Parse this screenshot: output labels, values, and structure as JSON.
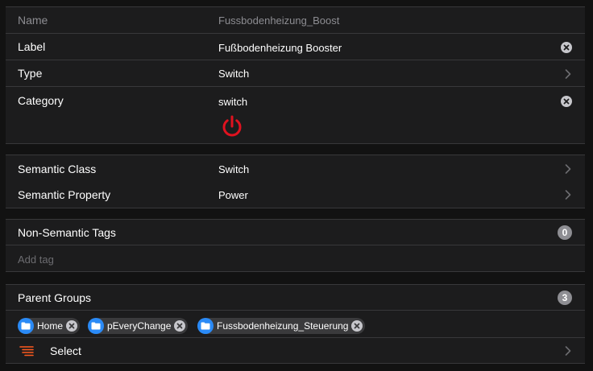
{
  "item": {
    "name_label": "Name",
    "name_value": "Fussbodenheizung_Boost",
    "label_label": "Label",
    "label_value": "Fußbodenheizung Booster",
    "type_label": "Type",
    "type_value": "Switch",
    "category_label": "Category",
    "category_value": "switch",
    "category_icon": "power-icon"
  },
  "semantics": {
    "class_label": "Semantic Class",
    "class_value": "Switch",
    "property_label": "Semantic Property",
    "property_value": "Power"
  },
  "tags": {
    "title": "Non-Semantic Tags",
    "count": "0",
    "add_placeholder": "Add tag"
  },
  "groups": {
    "title": "Parent Groups",
    "count": "3",
    "chips": [
      {
        "label": "Home",
        "icon": "folder-icon"
      },
      {
        "label": "pEveryChange",
        "icon": "folder-icon"
      },
      {
        "label": "Fussbodenheizung_Steuerung",
        "icon": "folder-icon"
      }
    ],
    "select_label": "Select",
    "select_icon": "list-select-icon"
  },
  "colors": {
    "accent_red": "#e0121f",
    "chip_blue": "#2a8af6",
    "select_icon_orange": "#ff5a1f"
  }
}
